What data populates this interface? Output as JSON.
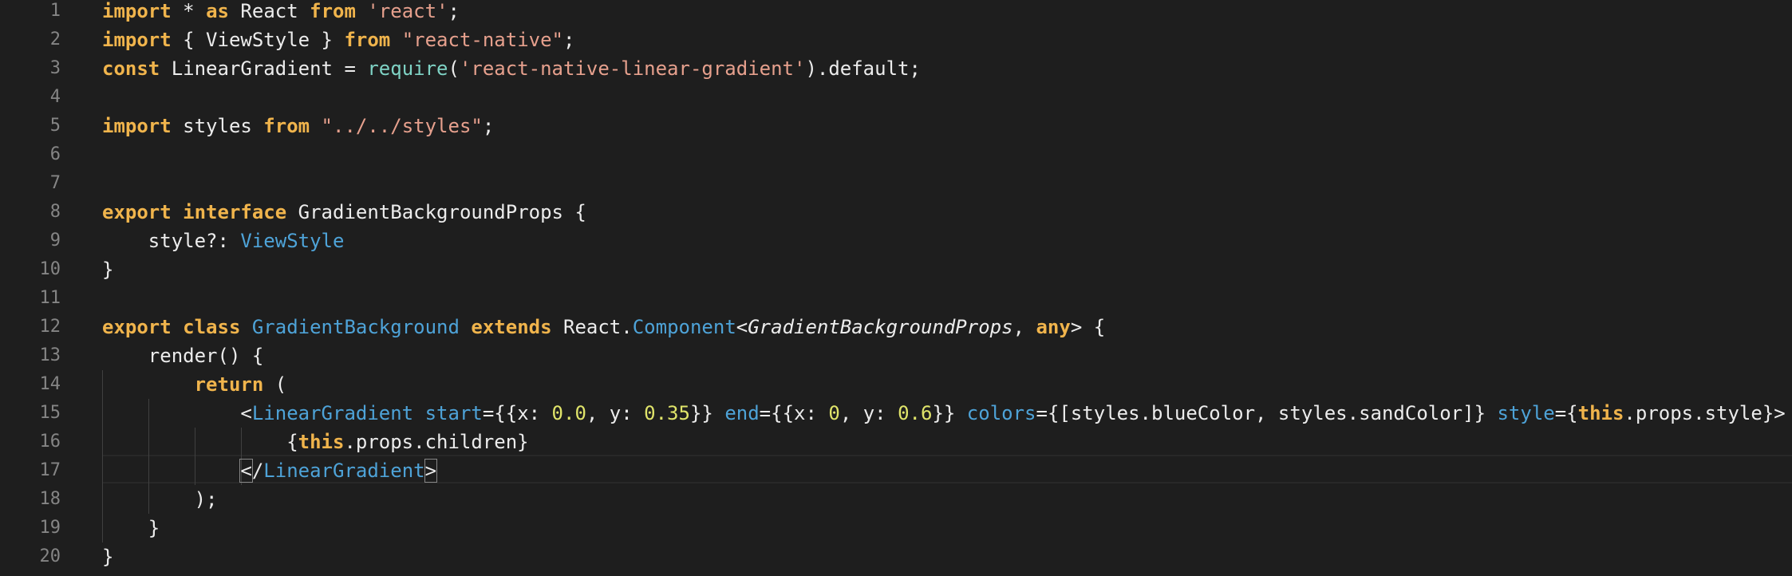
{
  "line_numbers": [
    "1",
    "2",
    "3",
    "4",
    "5",
    "6",
    "7",
    "8",
    "9",
    "10",
    "11",
    "12",
    "13",
    "14",
    "15",
    "16",
    "17",
    "18",
    "19",
    "20"
  ],
  "colors": {
    "background": "#1e1e1e",
    "keyword": "#f0b44c",
    "string": "#e6a08d",
    "type": "#4ea3d8",
    "number": "#e0e46a",
    "function": "#7fd3c5",
    "line_number": "#858585"
  },
  "code": {
    "l1": [
      "import",
      " * ",
      "as",
      " React ",
      "from",
      " ",
      "'react'",
      ";"
    ],
    "l2": [
      "import",
      " { ViewStyle } ",
      "from",
      " ",
      "\"react-native\"",
      ";"
    ],
    "l3": [
      "const",
      " LinearGradient = ",
      "require",
      "(",
      "'react-native-linear-gradient'",
      ").default;"
    ],
    "l5": [
      "import",
      " styles ",
      "from",
      " ",
      "\"../../styles\"",
      ";"
    ],
    "l8": [
      "export",
      " ",
      "interface",
      " GradientBackgroundProps {"
    ],
    "l9": [
      "    style?: ",
      "ViewStyle"
    ],
    "l10": [
      "}"
    ],
    "l12": [
      "export",
      " ",
      "class",
      " ",
      "GradientBackground",
      " ",
      "extends",
      " React.",
      "Component",
      "<",
      "GradientBackgroundProps",
      ", ",
      "any",
      "> {"
    ],
    "l13": [
      "    render() {"
    ],
    "l14": [
      "        ",
      "return",
      " ("
    ],
    "l15": [
      "            <",
      "LinearGradient",
      " ",
      "start",
      "={{x: ",
      "0.0",
      ", y: ",
      "0.35",
      "}} ",
      "end",
      "={{x: ",
      "0",
      ", y: ",
      "0.6",
      "}} ",
      "colors",
      "={[styles.blueColor, styles.sandColor]} ",
      "style",
      "={",
      "this",
      ".props.style}>"
    ],
    "l16": [
      "                {",
      "this",
      ".props.children}"
    ],
    "l17": [
      "            ",
      "<",
      "/",
      "LinearGradient",
      ">"
    ],
    "l18": [
      "        );"
    ],
    "l19": [
      "    }"
    ],
    "l20": [
      "}"
    ]
  }
}
